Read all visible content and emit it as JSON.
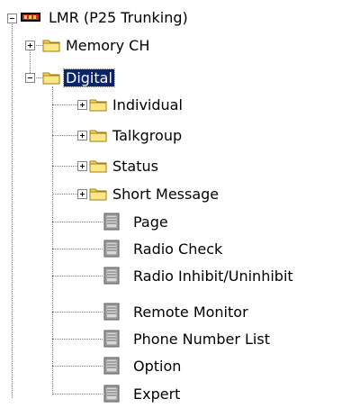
{
  "tree": {
    "root": {
      "label": "LMR (P25 Trunking)",
      "icon": "radio-device-icon",
      "expanded": true
    },
    "level1": [
      {
        "label": "Memory CH",
        "icon": "folder-icon",
        "expanded": false
      },
      {
        "label": "Digital",
        "icon": "folder-open-icon",
        "expanded": true,
        "selected": true
      }
    ],
    "digital_children": [
      {
        "label": "Individual",
        "icon": "folder-icon",
        "expandable": true
      },
      {
        "label": "Talkgroup",
        "icon": "folder-icon",
        "expandable": true
      },
      {
        "label": "Status",
        "icon": "folder-icon",
        "expandable": true
      },
      {
        "label": "Short Message",
        "icon": "folder-icon",
        "expandable": true
      },
      {
        "label": "Page",
        "icon": "document-icon",
        "expandable": false
      },
      {
        "label": "Radio Check",
        "icon": "document-icon",
        "expandable": false
      },
      {
        "label": "Radio Inhibit/Uninhibit",
        "icon": "document-icon",
        "expandable": false
      },
      {
        "label": "Remote Monitor",
        "icon": "document-icon",
        "expandable": false
      },
      {
        "label": "Phone Number List",
        "icon": "document-icon",
        "expandable": false
      },
      {
        "label": "Option",
        "icon": "document-icon",
        "expandable": false
      },
      {
        "label": "Expert",
        "icon": "document-icon",
        "expandable": false
      }
    ]
  },
  "colors": {
    "selection": "#0a246a",
    "folder": "#f8d858",
    "dotted_line": "#808080"
  }
}
